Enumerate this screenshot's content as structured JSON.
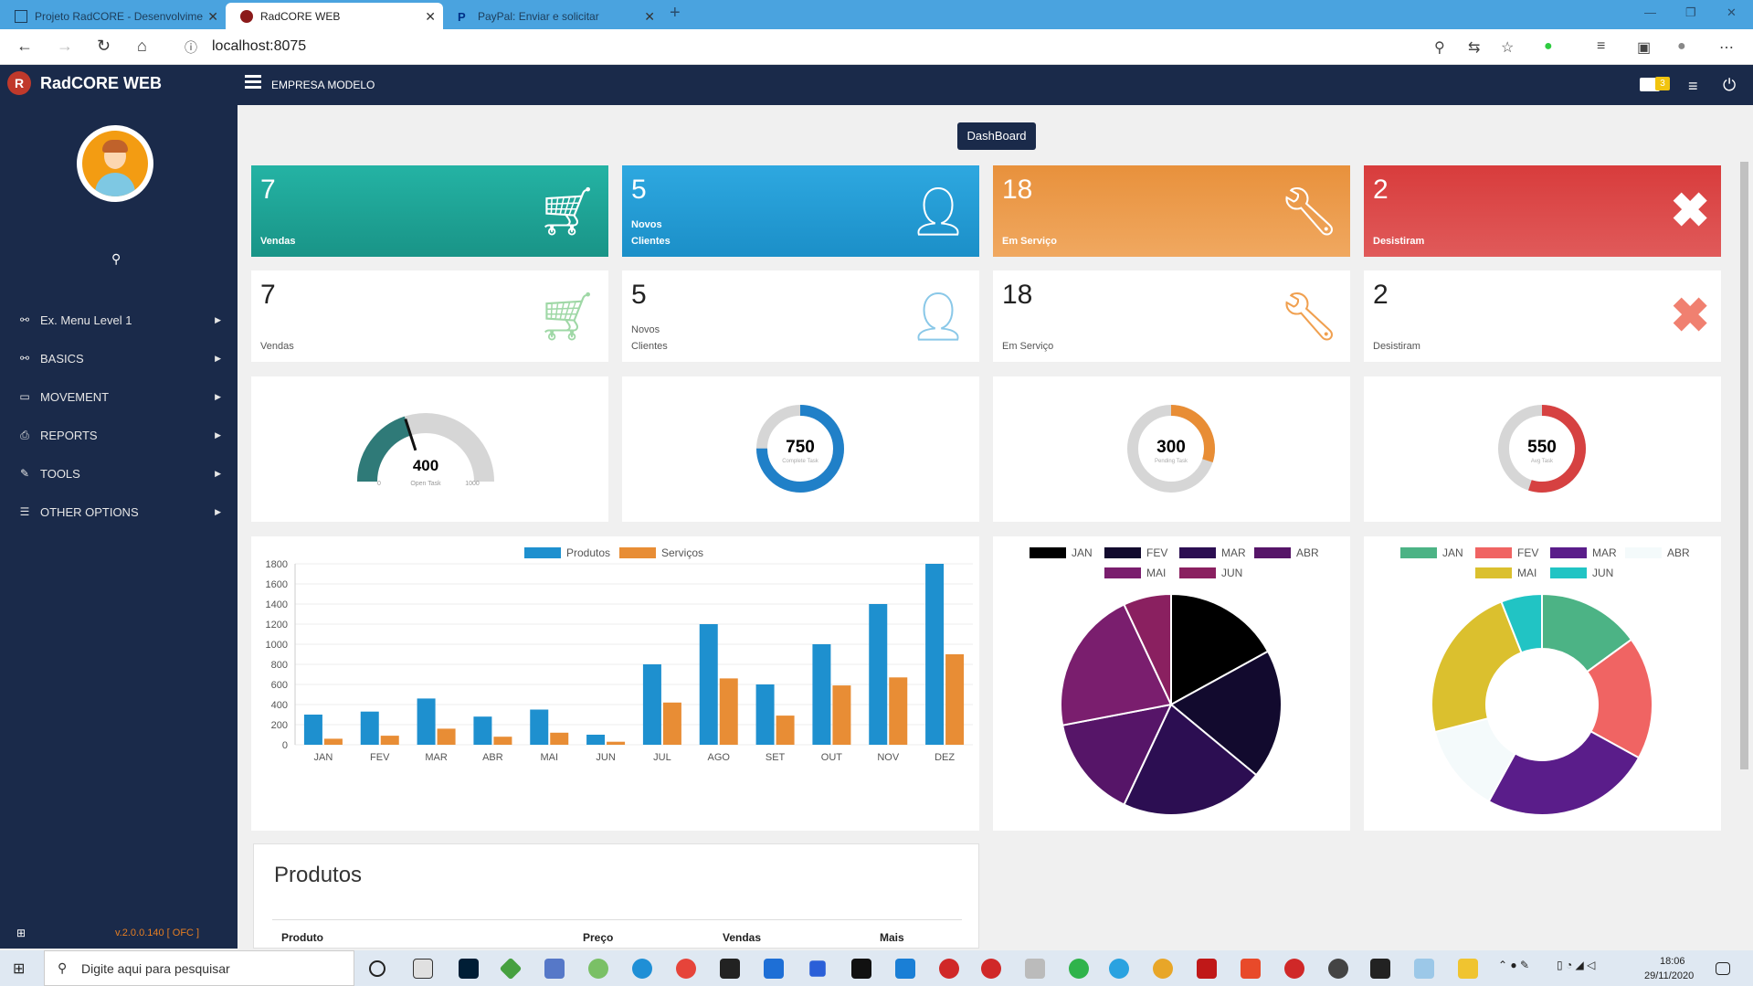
{
  "browser": {
    "tabs": [
      {
        "title": "Projeto RadCORE - Desenvolvime"
      },
      {
        "title": "RadCORE WEB"
      },
      {
        "title": "PayPal: Enviar e solicitar"
      }
    ],
    "new_tab": "+",
    "url": "localhost:8075"
  },
  "header": {
    "brand": "RadCORE WEB",
    "company": "EMPRESA MODELO",
    "mail_count": "3"
  },
  "sidebar": {
    "items": [
      {
        "label": "Ex. Menu Level 1",
        "icon": "sitemap-icon"
      },
      {
        "label": "BASICS",
        "icon": "sitemap-icon"
      },
      {
        "label": "MOVEMENT",
        "icon": "money-icon"
      },
      {
        "label": "REPORTS",
        "icon": "print-icon"
      },
      {
        "label": "TOOLS",
        "icon": "wrench-icon"
      },
      {
        "label": "OTHER OPTIONS",
        "icon": "list-icon"
      }
    ],
    "version": "v.2.0.0.140 [ OFC ]"
  },
  "dashboard": {
    "button": "DashBoard",
    "stats": [
      {
        "value": "7",
        "label1": "Vendas",
        "label2": "",
        "color": "#1fa79a"
      },
      {
        "value": "5",
        "label1": "Novos",
        "label2": "Clientes",
        "color": "#1e9cd6"
      },
      {
        "value": "18",
        "label1": "Em Serviço",
        "label2": "",
        "color": "#e88d35"
      },
      {
        "value": "2",
        "label1": "Desistiram",
        "label2": "",
        "color": "#d64141"
      }
    ],
    "white_stats": [
      {
        "value": "7",
        "label1": "Vendas",
        "label2": ""
      },
      {
        "value": "5",
        "label1": "Novos",
        "label2": "Clientes"
      },
      {
        "value": "18",
        "label1": "Em Serviço",
        "label2": ""
      },
      {
        "value": "2",
        "label1": "Desistiram",
        "label2": ""
      }
    ],
    "gauges": [
      {
        "value": "400",
        "caption": "Open Task",
        "min": "0",
        "max": "1000",
        "fraction": 0.4,
        "color": "#2f7a78"
      },
      {
        "value": "750",
        "caption": "Complete Task",
        "fraction": 0.75,
        "color": "#2080c8"
      },
      {
        "value": "300",
        "caption": "Pending Task",
        "fraction": 0.3,
        "color": "#e88d35"
      },
      {
        "value": "550",
        "caption": "Avg Task",
        "fraction": 0.55,
        "color": "#d64141"
      }
    ]
  },
  "chart_data": [
    {
      "type": "bar",
      "categories": [
        "JAN",
        "FEV",
        "MAR",
        "ABR",
        "MAI",
        "JUN",
        "JUL",
        "AGO",
        "SET",
        "OUT",
        "NOV",
        "DEZ"
      ],
      "series": [
        {
          "name": "Produtos",
          "color": "#1e90cf",
          "values": [
            300,
            330,
            460,
            280,
            350,
            100,
            800,
            1200,
            600,
            1000,
            1400,
            1800
          ]
        },
        {
          "name": "Serviços",
          "color": "#e88d35",
          "values": [
            60,
            90,
            160,
            80,
            120,
            30,
            420,
            660,
            290,
            590,
            670,
            900
          ]
        }
      ],
      "ylim": [
        0,
        1800
      ],
      "yticks": [
        "1800",
        "1600",
        "1400",
        "1200",
        "1000",
        "800",
        "600",
        "400",
        "200",
        "0"
      ]
    },
    {
      "type": "pie",
      "categories": [
        "JAN",
        "FEV",
        "MAR",
        "ABR",
        "MAI",
        "JUN"
      ],
      "colors": [
        "#000000",
        "#120a2e",
        "#2c0e52",
        "#561568",
        "#7a1e6e",
        "#8a2060"
      ],
      "values": [
        17,
        19,
        21,
        15,
        21,
        7
      ]
    },
    {
      "type": "pie",
      "donut": true,
      "categories": [
        "JAN",
        "FEV",
        "MAR",
        "ABR",
        "MAI",
        "JUN"
      ],
      "colors": [
        "#4cb385",
        "#f06463",
        "#5a1d8a",
        "#f4fafb",
        "#dbc02e",
        "#21c4c4"
      ],
      "values": [
        15,
        18,
        25,
        13,
        23,
        6
      ]
    }
  ],
  "products": {
    "title": "Produtos",
    "columns": [
      "Produto",
      "Preço",
      "Vendas",
      "Mais"
    ]
  },
  "taskbar": {
    "search_placeholder": "Digite aqui para pesquisar",
    "time": "18:06",
    "date": "29/11/2020"
  }
}
